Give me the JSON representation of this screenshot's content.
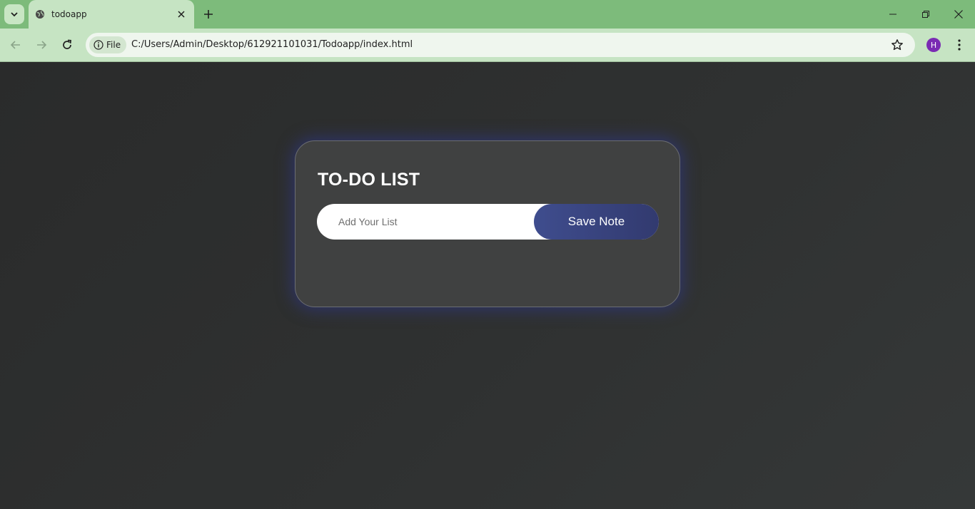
{
  "browser": {
    "tab_title": "todoapp",
    "address_chip": "File",
    "url": "C:/Users/Admin/Desktop/612921101031/Todoapp/index.html",
    "profile_initial": "H",
    "theme_color": "#7dbb7b",
    "profile_color": "#7a2bb3"
  },
  "app": {
    "title": "TO-DO LIST",
    "input_placeholder": "Add Your List",
    "input_value": "",
    "save_button_label": "Save Note",
    "accent_color": "#3f4d8e"
  }
}
